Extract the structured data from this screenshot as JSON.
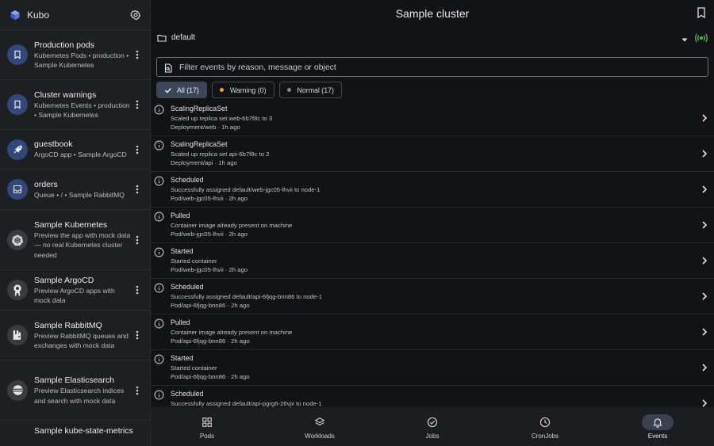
{
  "app": {
    "name": "Kubo"
  },
  "sidebar": {
    "items": [
      {
        "title": "Production pods",
        "subtitle": "Kubernetes Pods • production • Sample Kubernetes",
        "icon": "bookmark-icon"
      },
      {
        "title": "Cluster warnings",
        "subtitle": "Kubernetes Events • production • Sample Kubernetes",
        "icon": "bookmark-icon"
      },
      {
        "title": "guestbook",
        "subtitle": "ArgoCD app • Sample ArgoCD",
        "icon": "rocket-icon"
      },
      {
        "title": "orders",
        "subtitle": "Queue • / • Sample RabbitMQ",
        "icon": "inbox-icon"
      },
      {
        "title": "Sample Kubernetes",
        "subtitle": "Preview the app with mock data — no real Kubernetes cluster needed",
        "icon": "kubernetes-icon"
      },
      {
        "title": "Sample ArgoCD",
        "subtitle": "Preview ArgoCD apps with mock data",
        "icon": "argocd-icon"
      },
      {
        "title": "Sample RabbitMQ",
        "subtitle": "Preview RabbitMQ queues and exchanges with mock data",
        "icon": "rabbitmq-icon"
      },
      {
        "title": "Sample Elasticsearch",
        "subtitle": "Preview Elasticsearch indices and search with mock data",
        "icon": "elasticsearch-icon"
      },
      {
        "title": "Sample kube-state-metrics",
        "subtitle": "",
        "icon": "metrics-icon"
      }
    ]
  },
  "header": {
    "title": "Sample cluster"
  },
  "namespace": {
    "value": "default"
  },
  "filter": {
    "placeholder": "Filter events by reason, message or object"
  },
  "chips": [
    {
      "label": "All (17)",
      "active": true
    },
    {
      "label": "Warning (0)",
      "dot_color": "#f5a623"
    },
    {
      "label": "Normal (17)",
      "dot_color": "#8a8c90"
    }
  ],
  "events": [
    {
      "reason": "ScalingReplicaSet",
      "message": "Scaled up replica set web-6b7f8c to 3",
      "object": "Deployment/web",
      "age": "1h ago"
    },
    {
      "reason": "ScalingReplicaSet",
      "message": "Scaled up replica set api-6b7f8c to 2",
      "object": "Deployment/api",
      "age": "1h ago"
    },
    {
      "reason": "Scheduled",
      "message": "Successfully assigned default/web-jgc05-lhvii to node-1",
      "object": "Pod/web-jgc05-lhvii",
      "age": "2h ago"
    },
    {
      "reason": "Pulled",
      "message": "Container image already present on machine",
      "object": "Pod/web-jgc05-lhvii",
      "age": "2h ago"
    },
    {
      "reason": "Started",
      "message": "Started container",
      "object": "Pod/web-jgc05-lhvii",
      "age": "2h ago"
    },
    {
      "reason": "Scheduled",
      "message": "Successfully assigned default/api-6fjqg-bnn86 to node-1",
      "object": "Pod/api-6fjqg-bnn86",
      "age": "2h ago"
    },
    {
      "reason": "Pulled",
      "message": "Container image already present on machine",
      "object": "Pod/api-6fjqg-bnn86",
      "age": "2h ago"
    },
    {
      "reason": "Started",
      "message": "Started container",
      "object": "Pod/api-6fjqg-bnn86",
      "age": "2h ago"
    },
    {
      "reason": "Scheduled",
      "message": "Successfully assigned default/api-pgrg6-26vjx to node-1",
      "object": "",
      "age": ""
    }
  ],
  "nav": [
    {
      "label": "Pods",
      "icon": "grid-icon"
    },
    {
      "label": "Workloads",
      "icon": "layers-icon"
    },
    {
      "label": "Jobs",
      "icon": "check-circle-icon"
    },
    {
      "label": "CronJobs",
      "icon": "clock-icon"
    },
    {
      "label": "Events",
      "icon": "bell-icon",
      "active": true
    }
  ],
  "colors": {
    "accent": "#3d4658",
    "live": "#4caf50",
    "avatar": "#33487a"
  }
}
